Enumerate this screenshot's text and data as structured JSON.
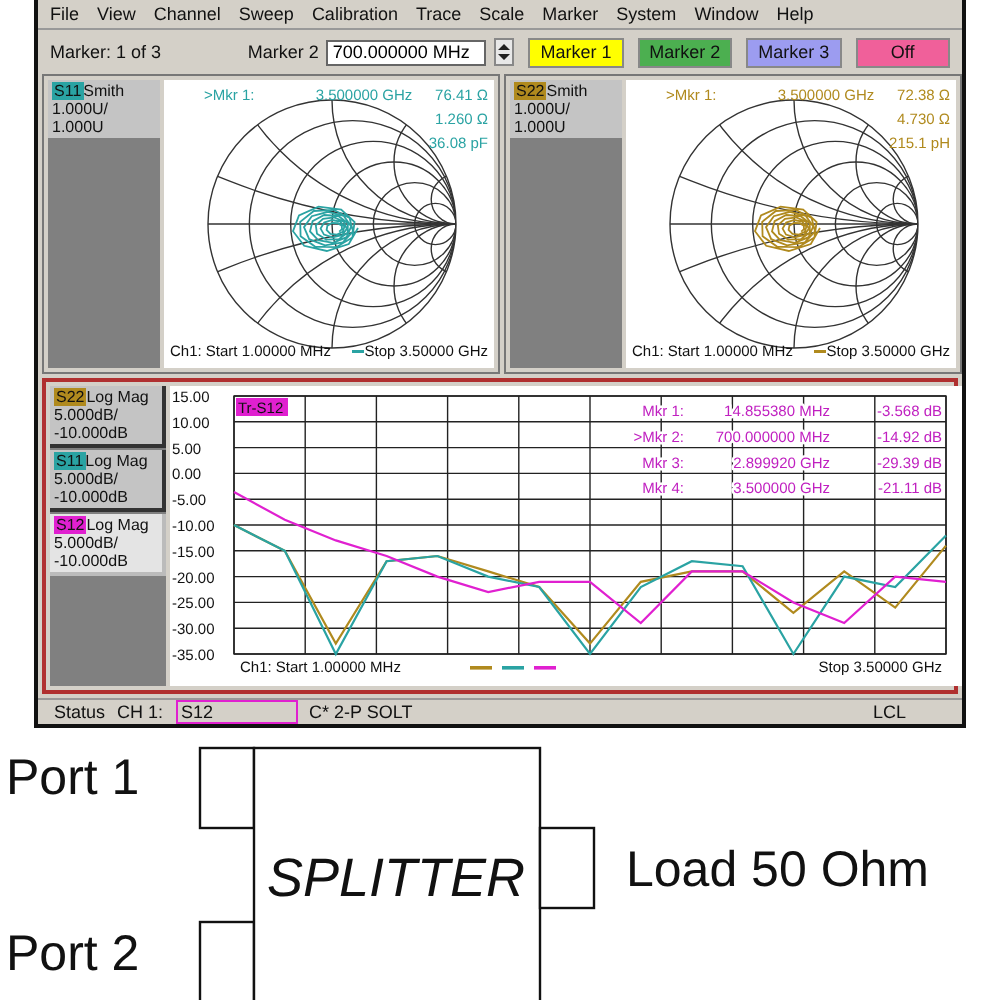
{
  "menu": [
    "File",
    "View",
    "Channel",
    "Sweep",
    "Calibration",
    "Trace",
    "Scale",
    "Marker",
    "System",
    "Window",
    "Help"
  ],
  "toolbar": {
    "marker_count": "Marker: 1 of 3",
    "marker_label": "Marker 2",
    "marker_value": "700.000000 MHz",
    "marker_buttons": [
      {
        "label": "Marker 1",
        "color": "#ffff00"
      },
      {
        "label": "Marker 2",
        "color": "#4caf50"
      },
      {
        "label": "Marker 3",
        "color": "#9c9cf0"
      },
      {
        "label": "Off",
        "color": "#f0609a"
      }
    ]
  },
  "smith_panes": [
    {
      "trace": "S11",
      "color": "#2aa3a3",
      "format": "Smith",
      "scale": [
        "1.000U/",
        "1.000U"
      ],
      "marker": {
        "label": ">Mkr 1:",
        "frequency": "3.500000 GHz",
        "readings": [
          "76.41 Ω",
          "1.260 Ω",
          "36.08 pF"
        ]
      },
      "start": "Ch1: Start 1.00000 MHz",
      "stop": "Stop 3.50000 GHz"
    },
    {
      "trace": "S22",
      "color": "#b08a1e",
      "format": "Smith",
      "scale": [
        "1.000U/",
        "1.000U"
      ],
      "marker": {
        "label": ">Mkr 1:",
        "frequency": "3.500000 GHz",
        "readings": [
          "72.38 Ω",
          "4.730 Ω",
          "215.1 pH"
        ]
      },
      "start": "Ch1: Start 1.00000 MHz",
      "stop": "Stop 3.50000 GHz"
    }
  ],
  "log_pane": {
    "traces": [
      {
        "format": "Log Mag",
        "scale": "5.000dB/",
        "reference": "-10.000dB",
        "selected": false
      },
      {
        "format": "Log Mag",
        "scale": "5.000dB/",
        "reference": "-10.000dB",
        "selected": false
      },
      {
        "format": "Log Mag",
        "scale": "5.000dB/",
        "reference": "-10.000dB",
        "selected": true
      }
    ],
    "chart_label": "Tr-S12",
    "markers": [
      {
        "label": "Mkr 1:",
        "frequency": "14.855380 MHz",
        "value": "-3.568 dB"
      },
      {
        "label": ">Mkr 2:",
        "frequency": "700.000000 MHz",
        "value": "-14.92 dB"
      },
      {
        "label": "Mkr 3:",
        "frequency": "2.899920 GHz",
        "value": "-29.39 dB"
      },
      {
        "label": "Mkr 4:",
        "frequency": "3.500000 GHz",
        "value": "-21.11 dB"
      }
    ],
    "start": "Ch1: Start 1.00000 MHz",
    "stop": "Stop 3.50000 GHz",
    "chart_data": {
      "type": "line",
      "ylim": [
        -35,
        15
      ],
      "grid": true,
      "categories": [
        null,
        null,
        null,
        null,
        null,
        null,
        null,
        null,
        null,
        null,
        null,
        null,
        null,
        null,
        null
      ],
      "yticks": [
        {
          "value": 15,
          "label": "15.00"
        },
        {
          "value": 10,
          "label": "10.00"
        },
        {
          "value": 5,
          "label": "5.00"
        },
        {
          "value": 0,
          "label": "0.00"
        },
        {
          "value": -5,
          "label": "-5.00"
        },
        {
          "value": -10,
          "label": "-10.00"
        },
        {
          "value": -15,
          "label": "-15.00"
        },
        {
          "value": -20,
          "label": "-20.00"
        },
        {
          "value": -25,
          "label": "-25.00"
        },
        {
          "value": -30,
          "label": "-30.00"
        },
        {
          "value": -35,
          "label": "-35.00"
        }
      ],
      "series": [
        {
          "name": "S22",
          "color": "#b08a1e",
          "values": [
            -10,
            -15,
            -33,
            -17,
            -16,
            -19,
            -22,
            -33,
            -21,
            -19,
            -19,
            -27,
            -19,
            -26,
            -14
          ]
        },
        {
          "name": "S11",
          "color": "#2aa3a3",
          "values": [
            -10,
            -15,
            -35,
            -17,
            -16,
            -20,
            -22,
            -35,
            -22,
            -17,
            -18,
            -35,
            -20,
            -22,
            -12
          ]
        },
        {
          "name": "S12",
          "color": "#e020d0",
          "values": [
            -3.6,
            -9,
            -13,
            -16,
            -20,
            -23,
            -21,
            -21,
            -29,
            -19,
            -19,
            -25,
            -29,
            -20,
            -21
          ]
        }
      ]
    }
  },
  "status_bar": {
    "label": "Status",
    "channel": "CH 1:",
    "trace": "S12",
    "calibration": "C* 2-P SOLT",
    "mode": "LCL"
  },
  "diagram": {
    "block": "SPLITTER",
    "ports": [
      "Port 1",
      "Port 2"
    ],
    "load": "Load 50 Ohm"
  }
}
